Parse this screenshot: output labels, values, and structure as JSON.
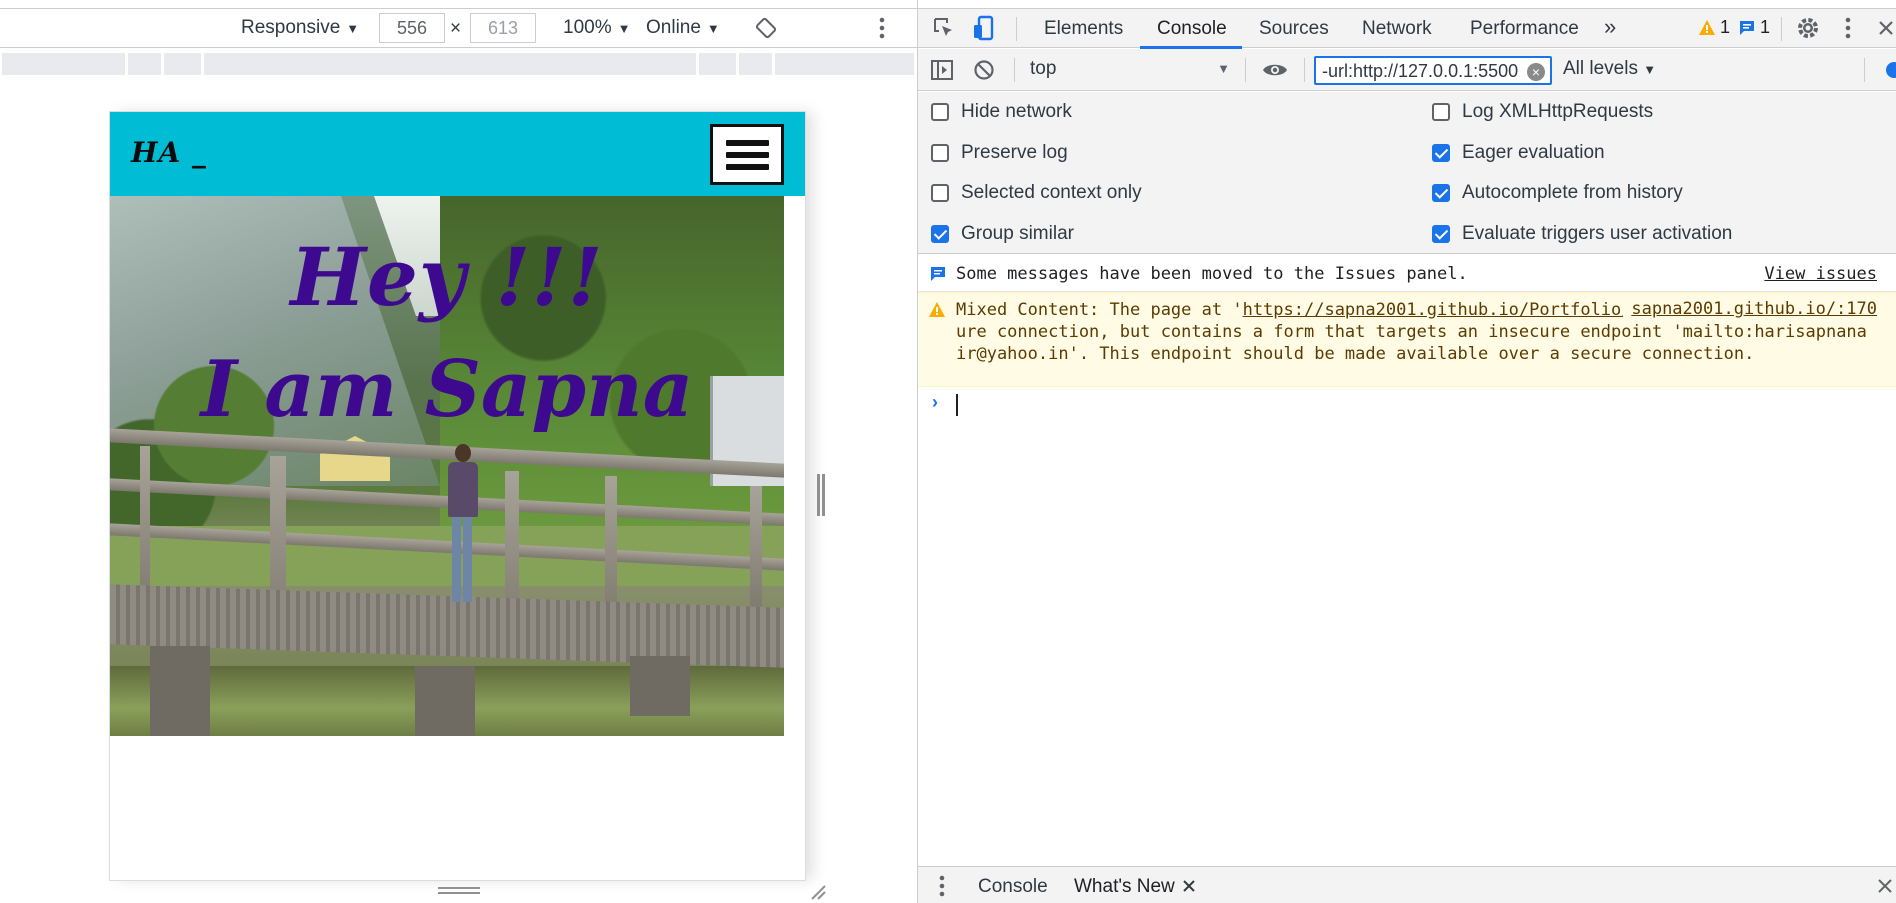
{
  "device_toolbar": {
    "device_label": "Responsive",
    "width_value": "556",
    "times_sign": "×",
    "height_value": "613",
    "zoom_label": "100%",
    "throttle_label": "Online"
  },
  "site": {
    "logo_text": "HA _",
    "hero_line1": "Hey !!!",
    "hero_line2": "I am Sapna"
  },
  "devtools": {
    "tabs": [
      "Elements",
      "Console",
      "Sources",
      "Network",
      "Performance"
    ],
    "more_tabs_glyph": "»",
    "active_tab": "Console",
    "warning_count": "1",
    "issue_count": "1"
  },
  "console_toolbar": {
    "context": "top",
    "filter_value": "-url:http://127.0.0.1:5500",
    "levels_label": "All levels"
  },
  "settings": {
    "left": [
      {
        "label": "Hide network",
        "checked": false
      },
      {
        "label": "Preserve log",
        "checked": false
      },
      {
        "label": "Selected context only",
        "checked": false
      },
      {
        "label": "Group similar",
        "checked": true
      }
    ],
    "right": [
      {
        "label": "Log XMLHttpRequests",
        "checked": false
      },
      {
        "label": "Eager evaluation",
        "checked": true
      },
      {
        "label": "Autocomplete from history",
        "checked": true
      },
      {
        "label": "Evaluate triggers user activation",
        "checked": true
      }
    ]
  },
  "messages": {
    "issues_text": "Some messages have been moved to the Issues panel.",
    "view_issues": "View issues",
    "warning_prefix": "Mixed Content: The page at '",
    "warning_link": "https://sapna2001.github.io/Portfolio/",
    "warning_source": "sapna2001.github.io/:170",
    "warning_suffix": "' was loaded over a secure connection, but contains a form that targets an insecure endpoint 'mailto:harisapnanair@yahoo.in'. This endpoint should be made available over a secure connection."
  },
  "drawer": {
    "tabs": [
      "Console",
      "What's New"
    ]
  },
  "colors": {
    "nav_bg": "#00bcd4",
    "hero_text": "#3d0a8f",
    "accent": "#1a73e8",
    "warning_bg": "#fffbe5"
  }
}
